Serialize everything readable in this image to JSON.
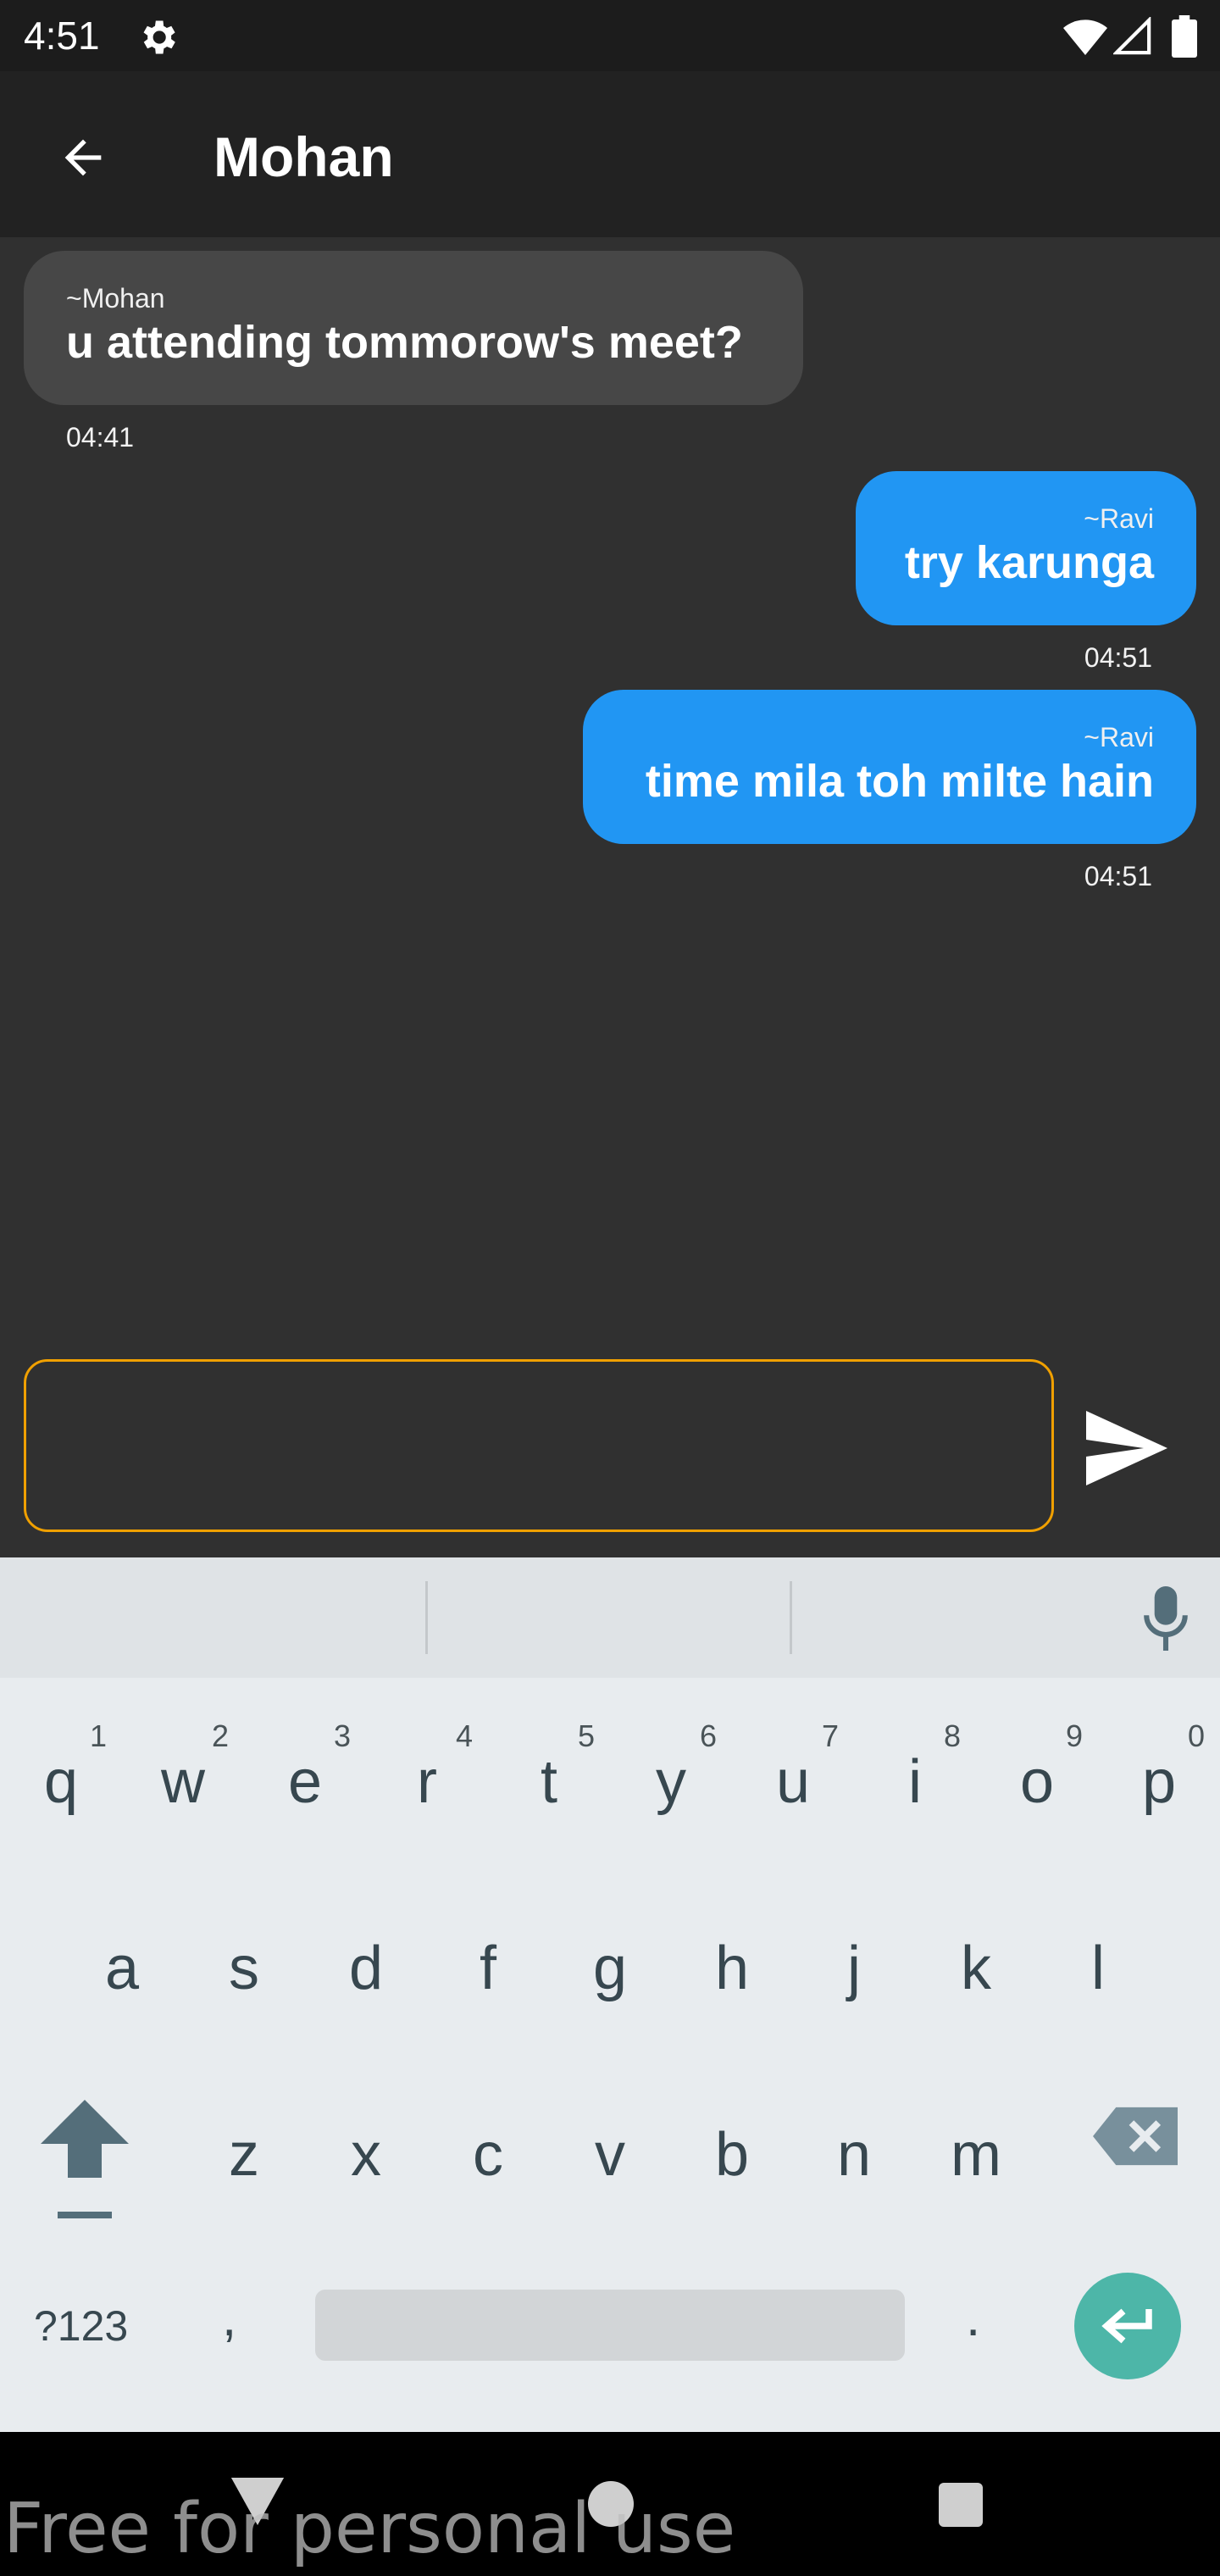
{
  "status_bar": {
    "time": "4:51",
    "icons": [
      "gear-icon",
      "wifi-icon",
      "signal-icon",
      "battery-icon"
    ]
  },
  "app_bar": {
    "title": "Mohan",
    "back_icon": "arrow-left-icon"
  },
  "messages": [
    {
      "direction": "incoming",
      "sender": "~Mohan",
      "text": "u attending tommorow's meet?",
      "time": "04:41"
    },
    {
      "direction": "outgoing",
      "sender": "~Ravi",
      "text": "try karunga",
      "time": "04:51"
    },
    {
      "direction": "outgoing",
      "sender": "~Ravi",
      "text": "time mila toh milte hain",
      "time": "04:51"
    }
  ],
  "composer": {
    "value": "",
    "placeholder": "",
    "send_icon": "send-icon"
  },
  "keyboard": {
    "row1": [
      {
        "char": "q",
        "hint": "1"
      },
      {
        "char": "w",
        "hint": "2"
      },
      {
        "char": "e",
        "hint": "3"
      },
      {
        "char": "r",
        "hint": "4"
      },
      {
        "char": "t",
        "hint": "5"
      },
      {
        "char": "y",
        "hint": "6"
      },
      {
        "char": "u",
        "hint": "7"
      },
      {
        "char": "i",
        "hint": "8"
      },
      {
        "char": "o",
        "hint": "9"
      },
      {
        "char": "p",
        "hint": "0"
      }
    ],
    "row2": [
      "a",
      "s",
      "d",
      "f",
      "g",
      "h",
      "j",
      "k",
      "l"
    ],
    "row3": [
      "z",
      "x",
      "c",
      "v",
      "b",
      "n",
      "m"
    ],
    "symbols_label": "?123",
    "comma": ",",
    "period": ".",
    "icons": [
      "mic-icon",
      "shift-icon",
      "backspace-icon",
      "enter-icon"
    ]
  },
  "nav_bar": {
    "icons": [
      "nav-back-icon",
      "nav-home-icon",
      "nav-recents-icon"
    ]
  },
  "watermark": "Free for personal use",
  "colors": {
    "background": "#303030",
    "app_bar": "#222222",
    "incoming_bubble": "#474747",
    "outgoing_bubble": "#2196f3",
    "input_border": "#f0a000",
    "enter_key": "#4db6a8"
  }
}
